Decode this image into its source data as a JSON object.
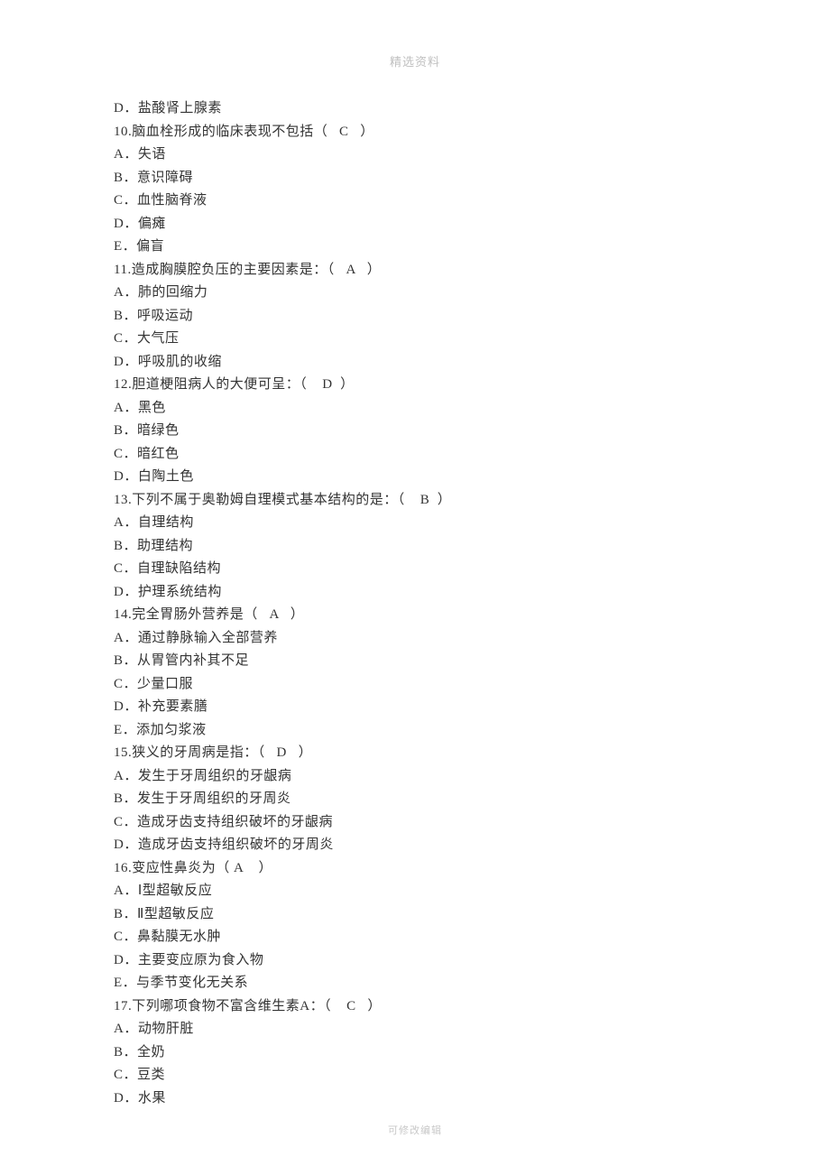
{
  "header": "精选资料",
  "footer": "可修改编辑",
  "lines": [
    "D．盐酸肾上腺素",
    "10.脑血栓形成的临床表现不包括（   C   ）",
    "A．失语",
    "B．意识障碍",
    "C．血性脑脊液",
    "D．偏瘫",
    "E．偏盲",
    "11.造成胸膜腔负压的主要因素是：（   A   ）",
    "A．肺的回缩力",
    "B．呼吸运动",
    "C．大气压",
    "D．呼吸肌的收缩",
    "12.胆道梗阻病人的大便可呈：（    D  ）",
    "A．黑色",
    "B．暗绿色",
    "C．暗红色",
    "D．白陶土色",
    "13.下列不属于奥勒姆自理模式基本结构的是：（    B  ）",
    "A．自理结构",
    "B．助理结构",
    "C．自理缺陷结构",
    "D．护理系统结构",
    "14.完全胃肠外营养是（   A   ）",
    "A．通过静脉输入全部营养",
    "B．从胃管内补其不足",
    "C．少量口服",
    "D．补充要素膳",
    "E．添加匀浆液",
    "15.狭义的牙周病是指：（   D   ）",
    "A．发生于牙周组织的牙龈病",
    "B．发生于牙周组织的牙周炎",
    "C．造成牙齿支持组织破坏的牙龈病",
    "D．造成牙齿支持组织破坏的牙周炎",
    "16.变应性鼻炎为（ A    ）",
    "A．Ⅰ型超敏反应",
    "B．Ⅱ型超敏反应",
    "C．鼻黏膜无水肿",
    "D．主要变应原为食入物",
    "E．与季节变化无关系",
    "17.下列哪项食物不富含维生素A：（    C   ）",
    "A．动物肝脏",
    "B．全奶",
    "C．豆类",
    "D．水果"
  ]
}
